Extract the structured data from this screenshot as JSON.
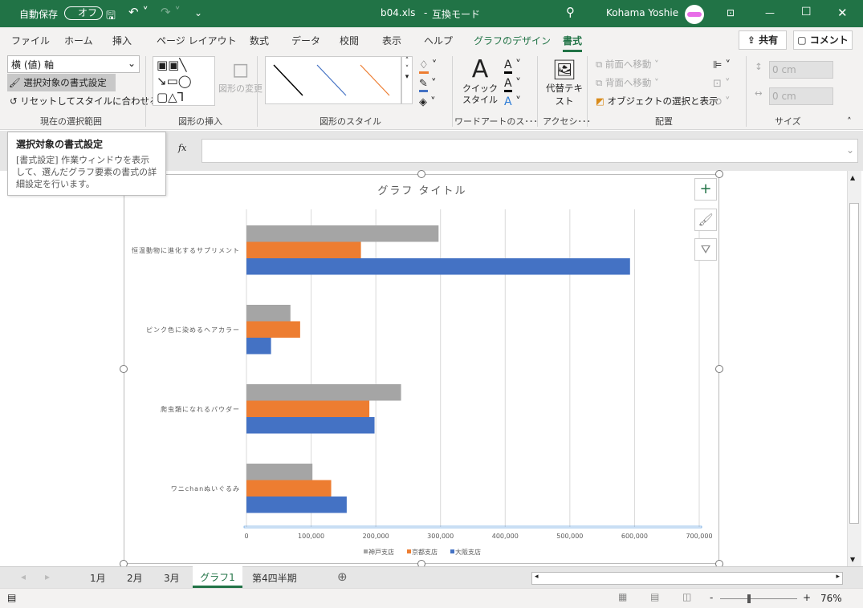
{
  "titlebar": {
    "autosave_label": "自動保存",
    "autosave_state": "オフ",
    "filename": "b04.xls",
    "mode": "互換モード",
    "user": "Kohama Yoshie",
    "accent": "#217346"
  },
  "tabs": [
    {
      "label": "ファイル"
    },
    {
      "label": "ホーム"
    },
    {
      "label": "挿入"
    },
    {
      "label": "ページ レイアウト"
    },
    {
      "label": "数式"
    },
    {
      "label": "データ"
    },
    {
      "label": "校閲"
    },
    {
      "label": "表示"
    },
    {
      "label": "ヘルプ"
    },
    {
      "label": "グラフのデザイン"
    },
    {
      "label": "書式",
      "active": true
    }
  ],
  "share_label": "共有",
  "comment_label": "コメント",
  "ribbon": {
    "selection_dropdown": "横 (値) 軸",
    "format_selection": "選択対象の書式設定",
    "reset_style": "リセットしてスタイルに合わせる",
    "group_current": "現在の選択範囲",
    "change_shape": "図形の変更",
    "group_insert": "図形の挿入",
    "group_styles": "図形のスタイル",
    "quick_style": "クイック スタイル",
    "group_wordart": "ワードアートのス･･･",
    "alt_text": "代替テキスト",
    "group_access": "アクセシ･･･",
    "bring_forward": "前面へ移動",
    "send_backward": "背面へ移動",
    "selection_pane": "オブジェクトの選択と表示",
    "group_arrange": "配置",
    "height_value": "0 cm",
    "width_value": "0 cm",
    "group_size": "サイズ"
  },
  "tooltip": {
    "title": "選択対象の書式設定",
    "body": "[書式設定] 作業ウィンドウを表示して、選んだグラフ要素の書式の詳細設定を行います。"
  },
  "formula": {
    "fx": "fx",
    "value": ""
  },
  "chart_data": {
    "type": "bar",
    "orientation": "horizontal",
    "title": "グラフ タイトル",
    "categories": [
      "恒温動物に進化するサプリメント",
      "ピンク色に染めるヘアカラー",
      "爬虫類になれるパウダー",
      "ワニchanぬいぐるみ"
    ],
    "series": [
      {
        "name": "神戸支店",
        "color": "#a5a5a5",
        "values": [
          297000,
          68000,
          239000,
          102000
        ]
      },
      {
        "name": "京都支店",
        "color": "#ed7d31",
        "values": [
          177000,
          83000,
          190000,
          131000
        ]
      },
      {
        "name": "大阪支店",
        "color": "#4472c4",
        "values": [
          593000,
          38000,
          198000,
          155000
        ]
      }
    ],
    "xlim": [
      0,
      700000
    ],
    "ticks": [
      "0",
      "100,000",
      "200,000",
      "300,000",
      "400,000",
      "500,000",
      "600,000",
      "700,000"
    ],
    "grid": true,
    "legend": "bottom"
  },
  "sheet_tabs": [
    {
      "label": "1月"
    },
    {
      "label": "2月"
    },
    {
      "label": "3月"
    },
    {
      "label": "グラフ1",
      "active": true
    },
    {
      "label": "第4四半期"
    }
  ],
  "status": {
    "zoom": "76%",
    "zoom_minus": "-",
    "zoom_plus": "+"
  }
}
